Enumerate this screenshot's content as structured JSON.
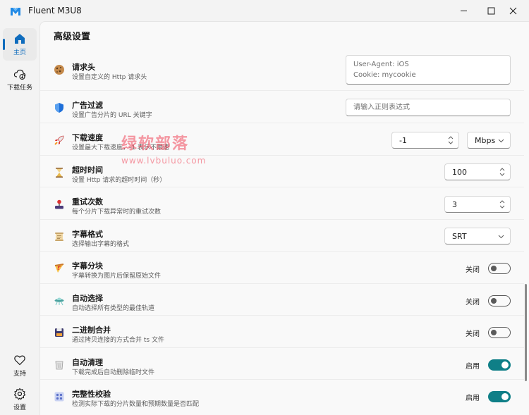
{
  "window": {
    "title": "Fluent M3U8"
  },
  "nav": {
    "items": [
      {
        "label": "主页",
        "icon": "home-icon",
        "active": true
      },
      {
        "label": "下载任务",
        "icon": "cloud-download-icon",
        "active": false
      },
      {
        "label": "支持",
        "icon": "heart-icon",
        "active": false
      },
      {
        "label": "设置",
        "icon": "gear-icon",
        "active": false
      }
    ]
  },
  "section": {
    "title": "高级设置"
  },
  "settings": {
    "headers": {
      "title": "请求头",
      "desc": "设置自定义的 Http 请求头",
      "placeholder_line1": "User-Agent: iOS",
      "placeholder_line2": "Cookie: mycookie",
      "icon": "cookie-icon"
    },
    "ad_filter": {
      "title": "广告过滤",
      "desc": "设置广告分片的 URL 关键字",
      "placeholder": "请输入正则表达式",
      "icon": "shield-icon"
    },
    "speed": {
      "title": "下载速度",
      "desc": "设置最大下载速度，-1 表示不限速",
      "value": "-1",
      "unit": "Mbps",
      "icon": "rocket-icon"
    },
    "timeout": {
      "title": "超时时间",
      "desc": "设置 Http 请求的超时时间（秒）",
      "value": "100",
      "icon": "hourglass-icon"
    },
    "retry": {
      "title": "重试次数",
      "desc": "每个分片下载异常时的重试次数",
      "value": "3",
      "icon": "joystick-icon"
    },
    "subtitle_format": {
      "title": "字幕格式",
      "desc": "选择输出字幕的格式",
      "value": "SRT",
      "icon": "scroll-icon"
    },
    "subtitle_split": {
      "title": "字幕分块",
      "desc": "字幕转换为图片后保留原始文件",
      "state_label": "关闭",
      "on": false,
      "icon": "pizza-icon"
    },
    "auto_select": {
      "title": "自动选择",
      "desc": "自动选择所有类型的最佳轨道",
      "state_label": "关闭",
      "on": false,
      "icon": "ufo-icon"
    },
    "binary_merge": {
      "title": "二进制合并",
      "desc": "通过拷贝连接的方式合并 ts 文件",
      "state_label": "关闭",
      "on": false,
      "icon": "floppy-icon"
    },
    "auto_clean": {
      "title": "自动清理",
      "desc": "下载完成后自动删除临时文件",
      "state_label": "启用",
      "on": true,
      "icon": "trash-icon"
    },
    "integrity": {
      "title": "完整性校验",
      "desc": "检测实际下载的分片数量和预期数量是否匹配",
      "state_label": "启用",
      "on": true,
      "icon": "grid-icon"
    }
  },
  "watermark": {
    "name": "绿软部落",
    "url": "www.lvbuluo.com"
  },
  "colors": {
    "accent": "#0f6cbd",
    "toggle_on": "#0f7f87",
    "background": "#f3f3f3",
    "card": "#f9f9f9"
  }
}
